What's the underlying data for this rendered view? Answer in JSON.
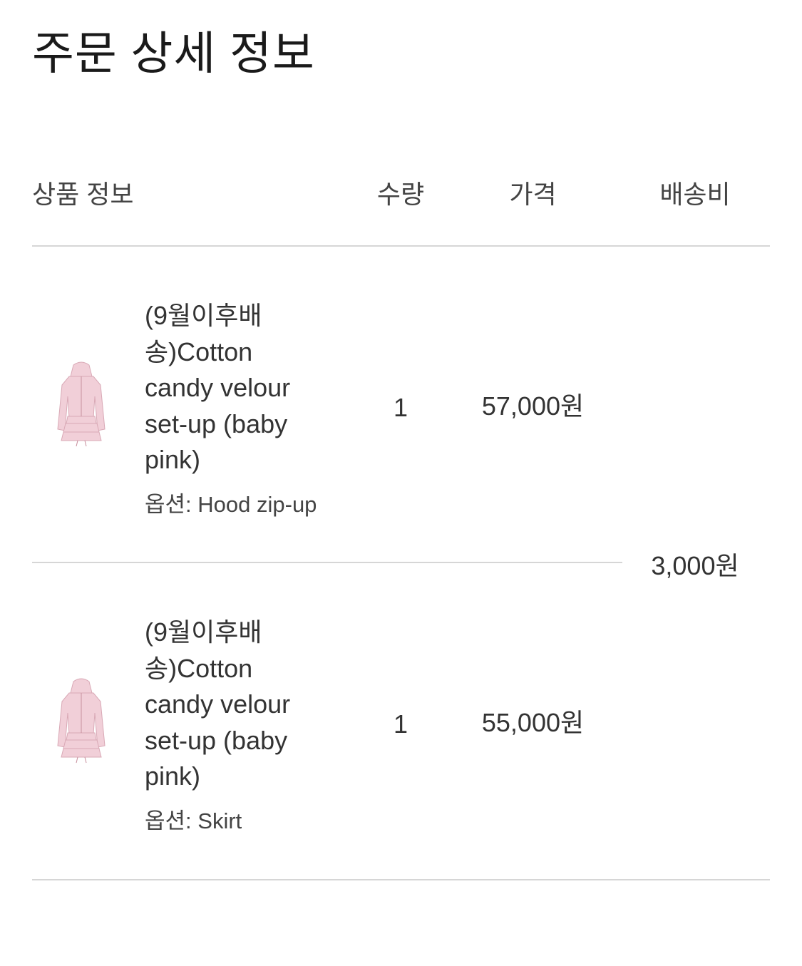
{
  "page": {
    "title": "주문 상세 정보"
  },
  "table": {
    "headers": {
      "product": "상품 정보",
      "quantity": "수량",
      "price": "가격",
      "shipping": "배송비"
    },
    "shipping_fee": "3,000원",
    "items": [
      {
        "name": "(9월이후배송)Cotton candy velour set-up (baby pink)",
        "option": "옵션: Hood zip-up",
        "quantity": "1",
        "price": "57,000원",
        "thumbnail_icon": "pink-jacket-product-image"
      },
      {
        "name": "(9월이후배송)Cotton candy velour set-up (baby pink)",
        "option": "옵션: Skirt",
        "quantity": "1",
        "price": "55,000원",
        "thumbnail_icon": "pink-jacket-product-image"
      }
    ]
  },
  "colors": {
    "product_pink": "#f1cfd8",
    "divider": "#d6d6d6",
    "text": "#333333"
  }
}
